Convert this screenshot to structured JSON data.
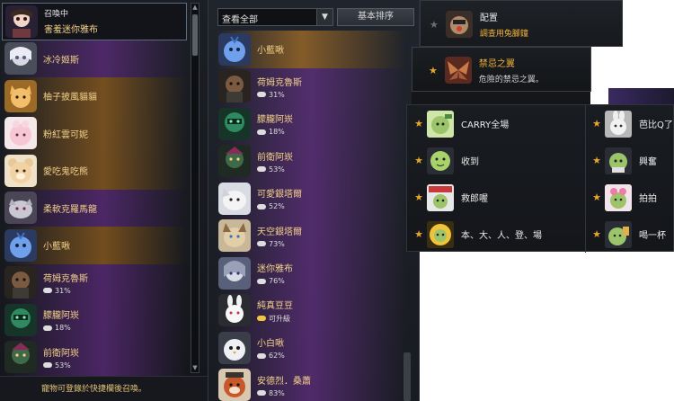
{
  "panel1": {
    "items": [
      {
        "status": "召喚中",
        "name": "害羞迷你雅布",
        "sub": "",
        "theme": "selected",
        "avatar": "baby-yabu-icon"
      },
      {
        "status": "",
        "name": "冰冷姬斯",
        "sub": "",
        "theme": "purple",
        "avatar": "ice-girl-icon"
      },
      {
        "status": "",
        "name": "柚子披風貓貓",
        "sub": "",
        "theme": "orange",
        "avatar": "cat-icon"
      },
      {
        "status": "",
        "name": "粉紅雲可妮",
        "sub": "",
        "theme": "orange",
        "avatar": "pink-cloud-icon"
      },
      {
        "status": "",
        "name": "愛吃鬼吃熊",
        "sub": "",
        "theme": "orange",
        "avatar": "bear-icon"
      },
      {
        "status": "",
        "name": "柔軟克羅馬龍",
        "sub": "",
        "theme": "purple",
        "avatar": "dragon-icon"
      },
      {
        "status": "",
        "name": "小藍啾",
        "sub": "",
        "theme": "orange",
        "avatar": "blue-bird-icon"
      },
      {
        "status": "",
        "name": "荷姆克魯斯",
        "sub": "31%",
        "theme": "purple",
        "avatar": "homunculus-icon"
      },
      {
        "status": "",
        "name": "朦朧阿崁",
        "sub": "18%",
        "theme": "purple",
        "avatar": "armor-icon"
      },
      {
        "status": "",
        "name": "前衛阿崁",
        "sub": "53%",
        "theme": "purple",
        "avatar": "warrior-icon"
      }
    ],
    "footer": "寵物可登錄於快捷欄後召喚。"
  },
  "panel2": {
    "dropdown": "查看全部",
    "sort_button": "基本排序",
    "items": [
      {
        "name": "小藍啾",
        "sub": "",
        "theme": "orange",
        "avatar": "blue-bird-icon"
      },
      {
        "name": "荷姆克魯斯",
        "sub": "31%",
        "theme": "purple",
        "avatar": "homunculus-icon"
      },
      {
        "name": "朦朧阿崁",
        "sub": "18%",
        "theme": "purple",
        "avatar": "armor-icon"
      },
      {
        "name": "前衛阿崁",
        "sub": "53%",
        "theme": "purple",
        "avatar": "warrior-icon"
      },
      {
        "name": "可愛銀塔爾",
        "sub": "52%",
        "theme": "purple",
        "avatar": "wolf-icon"
      },
      {
        "name": "天空銀塔爾",
        "sub": "73%",
        "theme": "purple",
        "avatar": "sky-wolf-icon"
      },
      {
        "name": "迷你雅布",
        "sub": "76%",
        "theme": "purple",
        "avatar": "mini-yabu-icon"
      },
      {
        "name": "純真豆豆",
        "sub": "可升級",
        "theme": "purple",
        "avatar": "rabbit-icon"
      },
      {
        "name": "小白啾",
        "sub": "62%",
        "theme": "purple",
        "avatar": "white-bird-icon"
      },
      {
        "name": "安德烈．桑蕭",
        "sub": "83%",
        "theme": "purple",
        "avatar": "red-panda-icon"
      }
    ]
  },
  "cards": [
    {
      "title": "配置",
      "sub": "調查用兔腳鐘",
      "star": "dim"
    },
    {
      "title": "禁忌之翼",
      "sub": "危險的禁忌之翼。",
      "star": "gold"
    }
  ],
  "emotes": {
    "left": [
      "CARRY全場",
      "收到",
      "救郎喔",
      "本、大、人、登、場"
    ],
    "right": [
      "芭比Q了",
      "興奮",
      "拍拍",
      "喝一杯"
    ]
  },
  "colors": {
    "name_gold": "#f3d089",
    "star": "#e8a62b",
    "purple": "#7d37a5",
    "orange": "#c8822a"
  }
}
